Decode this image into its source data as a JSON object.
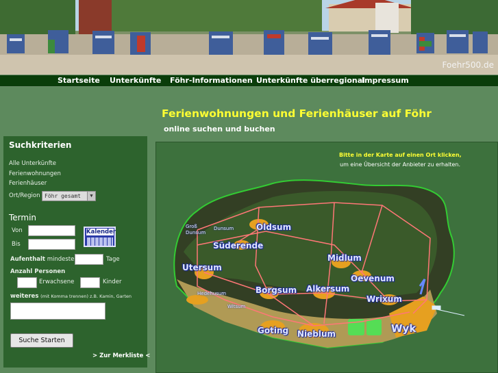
{
  "site_name": "Foehr500.de",
  "nav": [
    "Startseite",
    "Unterkünfte",
    "Föhr-Informationen",
    "Unterkünfte überregional",
    "Impressum"
  ],
  "main_title": "Ferienwohnungen und Ferienhäuser auf Föhr",
  "sub_title": "online suchen und buchen",
  "search": {
    "title": "Suchkriterien",
    "categories": [
      "Alle Unterkünfte",
      "Ferienwohnungen",
      "Ferienhäuser"
    ],
    "region_label": "Ort/Region",
    "region_value": "Föhr gesamt",
    "termin_title": "Termin",
    "von_label": "Von",
    "bis_label": "Bis",
    "kalender_label": "Kalender",
    "aufenthalt_label": "Aufenthalt",
    "aufenthalt_suffix": "mindestens",
    "tage_label": "Tage",
    "personen_title": "Anzahl Personen",
    "erwachsene_label": "Erwachsene",
    "kinder_label": "Kinder",
    "weiteres_label": "weiteres",
    "weiteres_hint": "(mit Komma trennen) z.B. Kamin, Garten",
    "submit_label": "Suche Starten",
    "merkliste_label": "> Zur Merkliste <"
  },
  "map": {
    "hint_line1": "Bitte in der Karte auf einen Ort klicken,",
    "hint_line2": "um eine Übersicht der Anbieter zu erhalten.",
    "towns": [
      "Oldsum",
      "Süderende",
      "Utersum",
      "Borgsum",
      "Midlum",
      "Oevenum",
      "Alkersum",
      "Wrixum",
      "Goting",
      "Nieblum",
      "Wyk"
    ],
    "small_towns": [
      "Groß Dunsum",
      "Dunsum",
      "Hedehusum",
      "Witsum"
    ]
  },
  "colors": {
    "page_bg": "#5d8a5d",
    "nav_bg": "#0a3d0a",
    "panel_bg": "#2d632d",
    "title_yellow": "#ffff33",
    "map_bg": "#3d713d"
  }
}
